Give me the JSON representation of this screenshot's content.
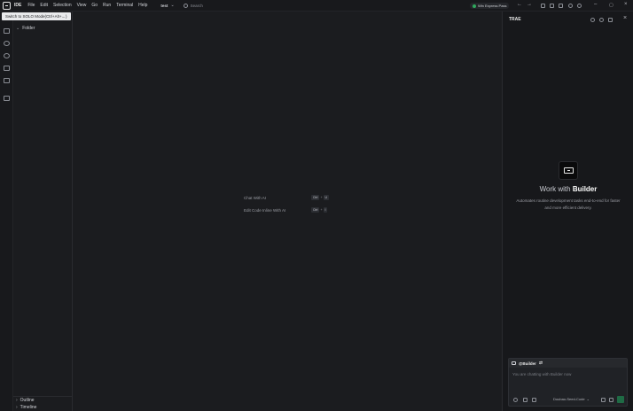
{
  "titlebar": {
    "app_name": "IDE",
    "menu": [
      "File",
      "Edit",
      "Selection",
      "View",
      "Go",
      "Run",
      "Terminal",
      "Help"
    ],
    "project": "test",
    "search_placeholder": "Search",
    "pro_badge": "Win Express Pass"
  },
  "tooltip": "Switch to SOLO Mode(Ctrl+Alt+←)",
  "sidebar": {
    "folder": "Folder",
    "outline": "Outline",
    "timeline": "Timeline"
  },
  "editor": {
    "hints": [
      {
        "label": "Chat With AI",
        "keys": [
          "Ctrl",
          "U"
        ]
      },
      {
        "label": "Edit Code Inline With AI",
        "keys": [
          "Ctrl",
          "I"
        ]
      }
    ]
  },
  "panel": {
    "title": "TRAE",
    "heading_prefix": "Work with",
    "heading_bold": "Builder",
    "description": "Automates routine development tasks end-to-end for faster and more efficient delivery.",
    "chat": {
      "agent": "@Builder",
      "placeholder": "You are chatting with Builder now",
      "model": "Doubao-Seed-Code"
    }
  },
  "colors": {
    "accent_green": "#2fa85c",
    "arrow_red": "#e5352b"
  }
}
